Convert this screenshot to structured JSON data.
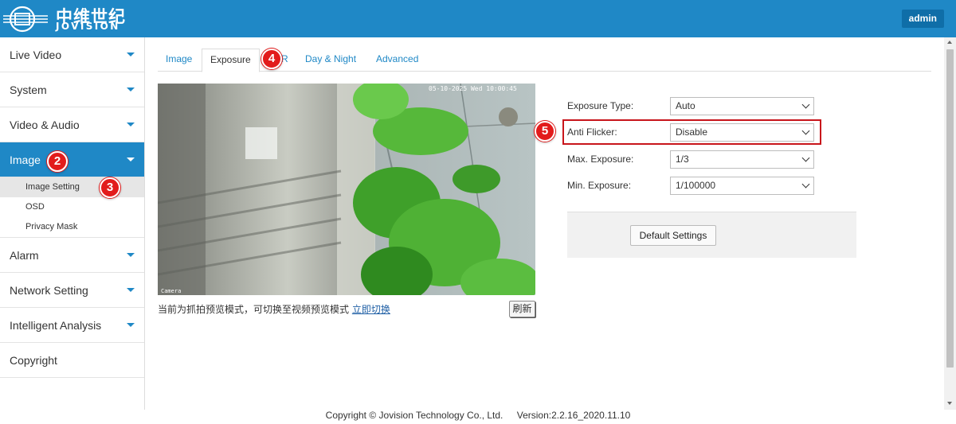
{
  "header": {
    "logo_cn": "中维世纪",
    "logo_en": "JOVISION",
    "user_label": "admin",
    "bar_color": "#1f88c6"
  },
  "sidebar": {
    "items": [
      {
        "label": "Live Video"
      },
      {
        "label": "System"
      },
      {
        "label": "Video & Audio"
      },
      {
        "label": "Image",
        "active": true,
        "marker": "2",
        "subitems": [
          {
            "label": "Image Setting",
            "selected": true,
            "marker": "3"
          },
          {
            "label": "OSD"
          },
          {
            "label": "Privacy Mask"
          }
        ]
      },
      {
        "label": "Alarm"
      },
      {
        "label": "Network Setting"
      },
      {
        "label": "Intelligent Analysis"
      },
      {
        "label": "Copyright"
      }
    ]
  },
  "tabs": [
    {
      "label": "Image"
    },
    {
      "label": "Exposure",
      "active": true,
      "marker": "4"
    },
    {
      "label": "R"
    },
    {
      "label": "Day & Night"
    },
    {
      "label": "Advanced"
    }
  ],
  "preview": {
    "osd_timestamp": "05-10-2025 Wed 10:00:45",
    "osd_name": "Camera",
    "caption": "当前为抓拍预览模式，可切换至视频预览模式",
    "switch_link": "立即切换",
    "refresh_label": "刷新"
  },
  "exposure_form": {
    "rows": [
      {
        "label": "Exposure Type:",
        "value": "Auto"
      },
      {
        "label": "Anti Flicker:",
        "value": "Disable",
        "marker": "5"
      },
      {
        "label": "Max. Exposure:",
        "value": "1/3"
      },
      {
        "label": "Min. Exposure:",
        "value": "1/100000"
      }
    ],
    "default_button": "Default Settings"
  },
  "footer": {
    "copyright": "Copyright © Jovision Technology Co., Ltd.",
    "version": "Version:2.2.16_2020.11.10"
  },
  "colors": {
    "accent": "#1f88c6",
    "marker": "#e21c1c",
    "highlight": "#c8151b"
  }
}
